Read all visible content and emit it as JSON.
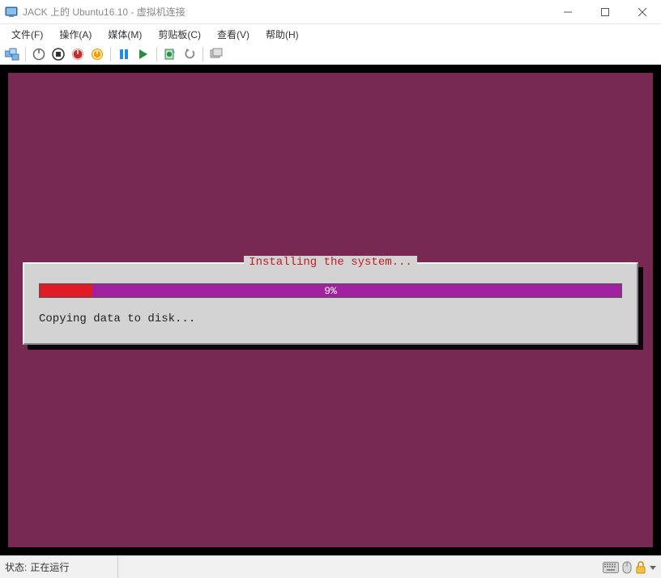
{
  "titlebar": {
    "title": "JACK 上的 Ubuntu16.10 - 虚拟机连接"
  },
  "menubar": {
    "items": [
      {
        "label": "文件(F)"
      },
      {
        "label": "操作(A)"
      },
      {
        "label": "媒体(M)"
      },
      {
        "label": "剪贴板(C)"
      },
      {
        "label": "查看(V)"
      },
      {
        "label": "帮助(H)"
      }
    ]
  },
  "installer": {
    "title": "Installing the system...",
    "progress_percent": 9,
    "progress_text": "9%",
    "status": "Copying data to disk..."
  },
  "statusbar": {
    "label": "状态:",
    "value": "正在运行"
  },
  "colors": {
    "ubuntu_bg": "#772953",
    "progress_bg": "#a020a0",
    "progress_fill": "#e01b24",
    "title_red": "#c01c28"
  }
}
